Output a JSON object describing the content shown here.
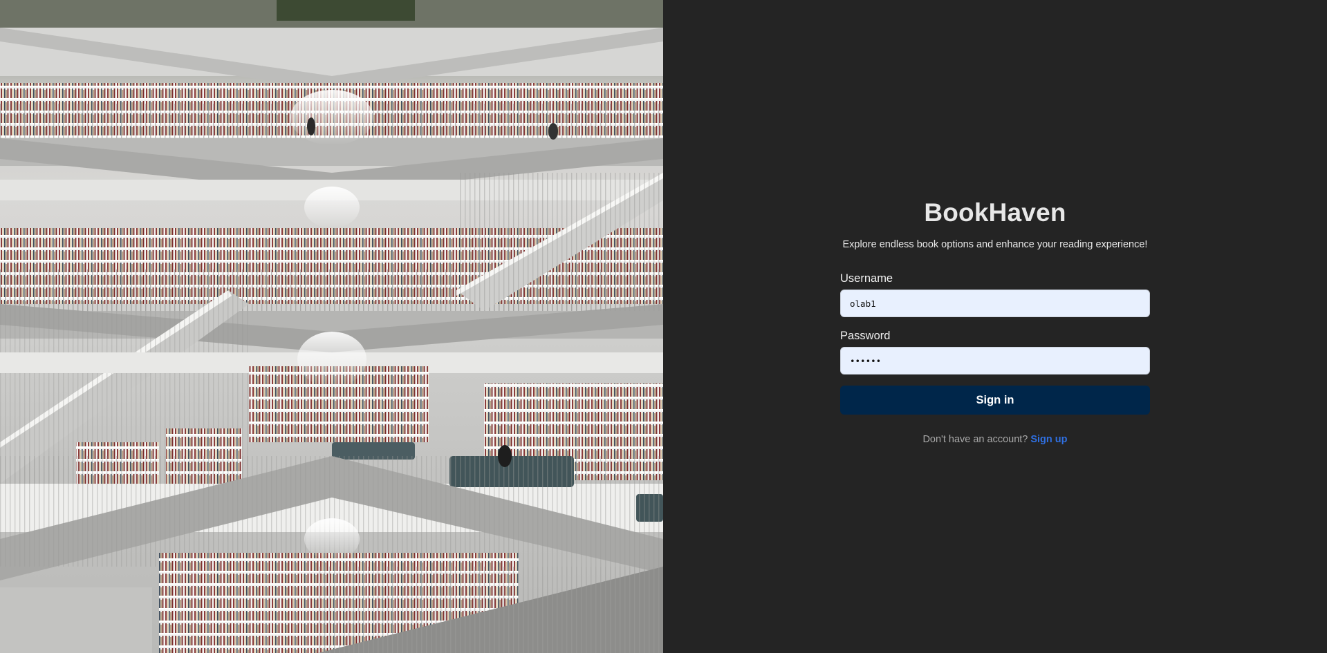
{
  "hero": {
    "image_label": "library-interior-photo"
  },
  "auth": {
    "title": "BookHaven",
    "tagline": "Explore endless book options and enhance your reading experience!",
    "username": {
      "label": "Username",
      "value": "olab1"
    },
    "password": {
      "label": "Password",
      "value": "••••••"
    },
    "signin_label": "Sign in",
    "signup_prompt": "Don't have an account?",
    "signup_link": "Sign up"
  },
  "colors": {
    "background": "#242424",
    "input_bg": "#e8f0fe",
    "button_bg": "#00264a",
    "link": "#2f6fe0"
  }
}
